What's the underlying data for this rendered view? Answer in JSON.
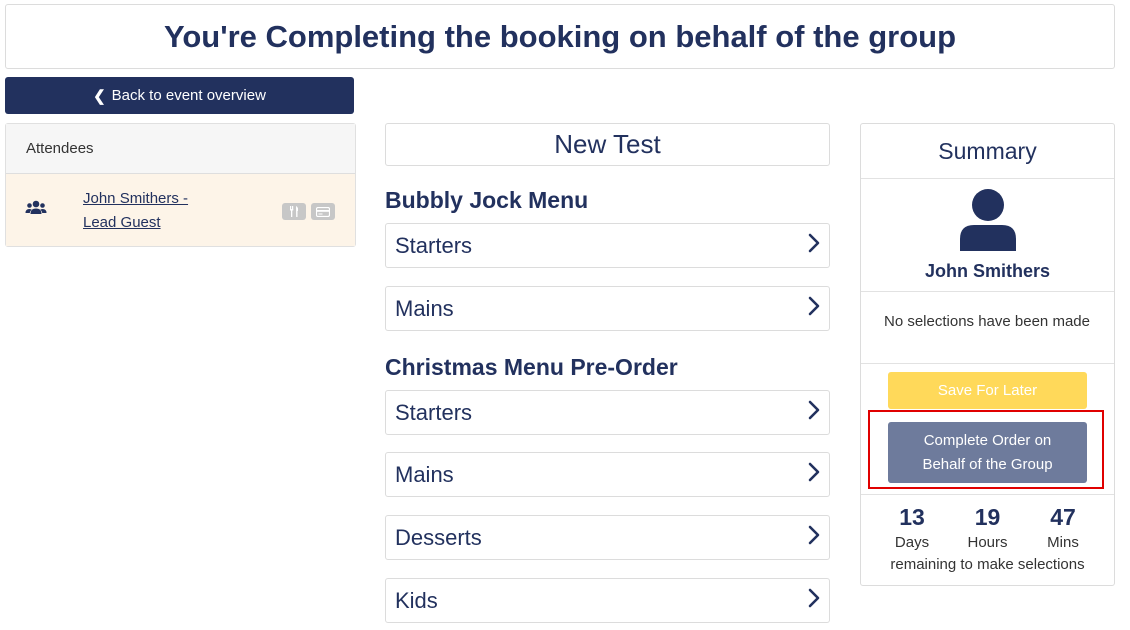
{
  "banner": {
    "title": "You're Completing the booking on behalf of the group"
  },
  "back_button": {
    "label": "Back to event overview"
  },
  "attendees": {
    "header": "Attendees",
    "items": [
      {
        "name_line1": "John Smithers -",
        "name_line2": "Lead Guest"
      }
    ]
  },
  "menu": {
    "title": "New Test",
    "sections": [
      {
        "title": "Bubbly Jock Menu",
        "items": [
          "Starters",
          "Mains"
        ]
      },
      {
        "title": "Christmas Menu Pre-Order",
        "items": [
          "Starters",
          "Mains",
          "Desserts",
          "Kids"
        ]
      }
    ]
  },
  "summary": {
    "title": "Summary",
    "user_name": "John Smithers",
    "message": "No selections have been made",
    "save_label": "Save For Later",
    "complete_label_line1": "Complete Order on",
    "complete_label_line2": "Behalf of the Group",
    "countdown": {
      "days": "13",
      "days_label": "Days",
      "hours": "19",
      "hours_label": "Hours",
      "mins": "47",
      "mins_label": "Mins",
      "note": "remaining to make selections"
    }
  },
  "colors": {
    "navy": "#22315e",
    "save_yellow": "#ffd95a",
    "complete_gray": "#6e7b9c",
    "highlight_red": "#e00000",
    "attendee_row_bg": "#fdf4e8"
  }
}
